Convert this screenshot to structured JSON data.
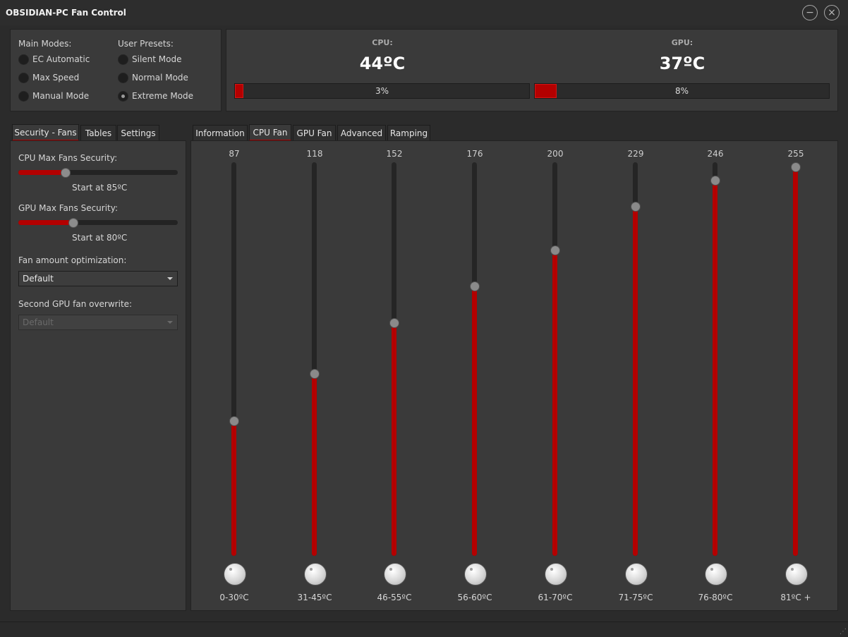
{
  "window": {
    "title": "OBSIDIAN-PC Fan Control"
  },
  "modes": {
    "main_title": "Main Modes:",
    "main": [
      {
        "label": "EC Automatic",
        "checked": false
      },
      {
        "label": "Max Speed",
        "checked": false
      },
      {
        "label": "Manual Mode",
        "checked": false
      }
    ],
    "presets_title": "User Presets:",
    "presets": [
      {
        "label": "Silent Mode",
        "checked": false
      },
      {
        "label": "Normal Mode",
        "checked": false
      },
      {
        "label": "Extreme Mode",
        "checked": true
      }
    ]
  },
  "temps": {
    "cpu": {
      "caption": "CPU:",
      "value": "44ºC",
      "percent_text": "3%",
      "percent": 3
    },
    "gpu": {
      "caption": "GPU:",
      "value": "37ºC",
      "percent_text": "8%",
      "percent": 8
    },
    "bar_color": "#b30000"
  },
  "left_tabs": [
    "Security - Fans",
    "Tables",
    "Settings"
  ],
  "security": {
    "cpu_label": "CPU Max Fans Security:",
    "cpu_level": 0.29,
    "cpu_start": "Start at 85ºC",
    "gpu_label": "GPU Max Fans Security:",
    "gpu_level": 0.34,
    "gpu_start": "Start at 80ºC",
    "opt_label": "Fan amount optimization:",
    "opt_value": "Default",
    "second_label": "Second GPU fan overwrite:",
    "second_value": "Default"
  },
  "right_tabs": [
    "Information",
    "CPU Fan",
    "GPU Fan",
    "Advanced",
    "Ramping"
  ],
  "cpu_fan": {
    "max": 255,
    "points": [
      {
        "value": 87,
        "range": "0-30ºC"
      },
      {
        "value": 118,
        "range": "31-45ºC"
      },
      {
        "value": 152,
        "range": "46-55ºC"
      },
      {
        "value": 176,
        "range": "56-60ºC"
      },
      {
        "value": 200,
        "range": "61-70ºC"
      },
      {
        "value": 229,
        "range": "71-75ºC"
      },
      {
        "value": 246,
        "range": "76-80ºC"
      },
      {
        "value": 255,
        "range": "81ºC +"
      }
    ]
  }
}
